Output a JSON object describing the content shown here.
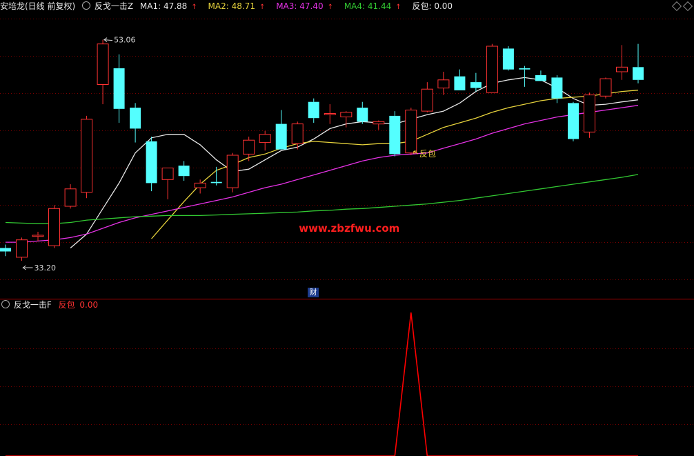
{
  "header": {
    "stock": "安培龙(日线 前复权)",
    "indicator": "反戈一击Z",
    "ma1_label": "MA1: 47.88",
    "ma2_label": "MA2: 48.71",
    "ma3_label": "MA3: 47.40",
    "ma4_label": "MA4: 41.44",
    "fanbao_label": "反包: 0.00"
  },
  "sub_header": {
    "indicator": "反戈一击F",
    "fanbao_name": "反包",
    "fanbao_value": "0.00"
  },
  "annotations": {
    "high": "53.06",
    "low": "33.20",
    "signal": "反包",
    "cai_badge": "财",
    "watermark": "www.zbzfwu.com"
  },
  "colors": {
    "up": "#ff3232",
    "down": "#54ffff",
    "ma1": "#e6e6e6",
    "ma2": "#e6d23c",
    "ma3": "#e632e6",
    "ma4": "#32c832",
    "signal": "#ff0000",
    "grid": "#7a0000"
  },
  "chart_data": [
    {
      "type": "candlestick",
      "title": "安培龙(日线 前复权)",
      "ylim": [
        31.5,
        55
      ],
      "candles": [
        {
          "o": 35.1,
          "h": 35.4,
          "l": 34.4,
          "c": 34.8
        },
        {
          "o": 34.3,
          "h": 36.0,
          "l": 34.0,
          "c": 35.8
        },
        {
          "o": 36.1,
          "h": 36.5,
          "l": 35.7,
          "c": 36.2
        },
        {
          "o": 35.3,
          "h": 38.8,
          "l": 35.1,
          "c": 38.5
        },
        {
          "o": 38.7,
          "h": 40.6,
          "l": 38.5,
          "c": 40.2
        },
        {
          "o": 39.9,
          "h": 46.5,
          "l": 39.4,
          "c": 46.2
        },
        {
          "o": 49.2,
          "h": 53.06,
          "l": 47.5,
          "c": 52.7
        },
        {
          "o": 50.6,
          "h": 51.8,
          "l": 45.9,
          "c": 47.1
        },
        {
          "o": 47.2,
          "h": 47.6,
          "l": 44.2,
          "c": 45.4
        },
        {
          "o": 44.3,
          "h": 44.7,
          "l": 40.0,
          "c": 40.7
        },
        {
          "o": 41.0,
          "h": 42.0,
          "l": 39.3,
          "c": 42.0
        },
        {
          "o": 42.2,
          "h": 42.6,
          "l": 40.9,
          "c": 41.3
        },
        {
          "o": 40.3,
          "h": 41.0,
          "l": 39.8,
          "c": 40.7
        },
        {
          "o": 40.8,
          "h": 42.1,
          "l": 40.5,
          "c": 40.7
        },
        {
          "o": 40.3,
          "h": 43.3,
          "l": 39.9,
          "c": 43.1
        },
        {
          "o": 43.2,
          "h": 44.7,
          "l": 42.6,
          "c": 44.4
        },
        {
          "o": 44.2,
          "h": 45.2,
          "l": 43.5,
          "c": 44.9
        },
        {
          "o": 45.8,
          "h": 47.0,
          "l": 44.4,
          "c": 43.6
        },
        {
          "o": 44.1,
          "h": 46.0,
          "l": 43.6,
          "c": 45.8
        },
        {
          "o": 47.7,
          "h": 48.0,
          "l": 45.9,
          "c": 46.3
        },
        {
          "o": 46.6,
          "h": 47.5,
          "l": 45.8,
          "c": 46.7
        },
        {
          "o": 46.4,
          "h": 46.9,
          "l": 45.5,
          "c": 46.8
        },
        {
          "o": 47.2,
          "h": 47.7,
          "l": 45.8,
          "c": 46.0
        },
        {
          "o": 45.8,
          "h": 46.1,
          "l": 45.3,
          "c": 46.0
        },
        {
          "o": 46.5,
          "h": 46.9,
          "l": 43.0,
          "c": 43.2
        },
        {
          "o": 43.3,
          "h": 47.2,
          "l": 43.1,
          "c": 47.0
        },
        {
          "o": 46.9,
          "h": 49.4,
          "l": 46.8,
          "c": 48.8
        },
        {
          "o": 48.9,
          "h": 50.3,
          "l": 48.3,
          "c": 49.6
        },
        {
          "o": 49.9,
          "h": 50.5,
          "l": 48.7,
          "c": 48.7
        },
        {
          "o": 49.4,
          "h": 50.2,
          "l": 48.6,
          "c": 48.9
        },
        {
          "o": 48.5,
          "h": 52.7,
          "l": 48.5,
          "c": 52.5
        },
        {
          "o": 52.3,
          "h": 52.5,
          "l": 50.4,
          "c": 50.5
        },
        {
          "o": 50.6,
          "h": 50.8,
          "l": 49.0,
          "c": 50.5
        },
        {
          "o": 50.0,
          "h": 50.4,
          "l": 49.6,
          "c": 49.5
        },
        {
          "o": 49.8,
          "h": 50.0,
          "l": 47.6,
          "c": 48.0
        },
        {
          "o": 47.6,
          "h": 47.7,
          "l": 44.3,
          "c": 44.5
        },
        {
          "o": 45.1,
          "h": 48.5,
          "l": 44.6,
          "c": 48.3
        },
        {
          "o": 48.2,
          "h": 49.8,
          "l": 48.0,
          "c": 49.7
        },
        {
          "o": 50.3,
          "h": 52.6,
          "l": 49.6,
          "c": 50.7
        },
        {
          "o": 50.7,
          "h": 52.7,
          "l": 49.3,
          "c": 49.6
        }
      ],
      "series": [
        {
          "name": "MA1",
          "values": [
            null,
            null,
            null,
            null,
            35.1,
            36.3,
            38.5,
            40.7,
            43.3,
            44.6,
            44.9,
            44.9,
            44.0,
            42.7,
            41.7,
            41.9,
            42.7,
            43.5,
            43.8,
            44.5,
            45.4,
            45.8,
            46.0,
            45.9,
            45.8,
            46.2,
            46.6,
            46.9,
            47.6,
            48.6,
            49.3,
            49.6,
            49.8,
            49.6,
            48.9,
            48.0,
            47.4,
            47.5,
            47.7,
            47.88
          ]
        },
        {
          "name": "MA2",
          "values": [
            null,
            null,
            null,
            null,
            null,
            null,
            null,
            null,
            null,
            35.9,
            37.5,
            39.1,
            40.6,
            41.8,
            42.3,
            42.9,
            43.2,
            43.7,
            44.1,
            44.3,
            44.2,
            44.1,
            44.0,
            44.1,
            44.1,
            44.3,
            44.9,
            45.5,
            45.9,
            46.3,
            46.8,
            47.2,
            47.5,
            47.8,
            48.0,
            48.1,
            48.2,
            48.4,
            48.6,
            48.71
          ]
        },
        {
          "name": "MA3",
          "values": [
            35.6,
            35.6,
            35.7,
            35.8,
            36.0,
            36.3,
            36.8,
            37.3,
            37.7,
            38.0,
            38.3,
            38.6,
            38.9,
            39.2,
            39.5,
            39.9,
            40.3,
            40.6,
            41.0,
            41.4,
            41.8,
            42.2,
            42.6,
            42.9,
            43.1,
            43.2,
            43.3,
            43.7,
            44.1,
            44.5,
            45.0,
            45.4,
            45.8,
            46.1,
            46.4,
            46.6,
            46.8,
            47.0,
            47.2,
            47.4
          ]
        },
        {
          "name": "MA4",
          "values": [
            37.3,
            37.25,
            37.2,
            37.2,
            37.3,
            37.5,
            37.6,
            37.7,
            37.8,
            37.85,
            37.9,
            37.9,
            37.9,
            37.95,
            38.0,
            38.05,
            38.1,
            38.15,
            38.2,
            38.3,
            38.35,
            38.45,
            38.5,
            38.6,
            38.7,
            38.8,
            38.9,
            39.05,
            39.2,
            39.4,
            39.6,
            39.8,
            40.0,
            40.2,
            40.4,
            40.6,
            40.8,
            41.0,
            41.2,
            41.44
          ]
        }
      ]
    },
    {
      "type": "line",
      "title": "反戈一击F",
      "ylim": [
        0,
        1
      ],
      "series": [
        {
          "name": "反包",
          "values": [
            0,
            0,
            0,
            0,
            0,
            0,
            0,
            0,
            0,
            0,
            0,
            0,
            0,
            0,
            0,
            0,
            0,
            0,
            0,
            0,
            0,
            0,
            0,
            0,
            0,
            1,
            0,
            0,
            0,
            0,
            0,
            0,
            0,
            0,
            0,
            0,
            0,
            0,
            0,
            0
          ]
        }
      ]
    }
  ]
}
